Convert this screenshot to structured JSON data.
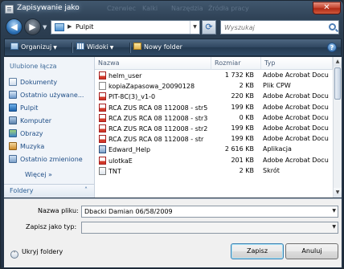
{
  "window": {
    "title": "Zapisywanie jako",
    "close_glyph": "✕",
    "ghost_menu": [
      "Czerwiec",
      "Kalki",
      "Narzędzia",
      "Źródła pracy"
    ]
  },
  "address": {
    "location": "Pulpit",
    "back_glyph": "◀",
    "forward_glyph": "▶",
    "refresh_glyph": "⟳"
  },
  "search": {
    "placeholder": "Wyszukaj"
  },
  "toolbar": {
    "organize": "Organizuj",
    "views": "Widoki",
    "new_folder": "Nowy folder",
    "help": "?"
  },
  "sidebar": {
    "heading": "Ulubione łącza",
    "items": [
      {
        "label": "Dokumenty",
        "icon": "documents-icon"
      },
      {
        "label": "Ostatnio używane...",
        "icon": "recent-places-icon"
      },
      {
        "label": "Pulpit",
        "icon": "desktop-icon"
      },
      {
        "label": "Komputer",
        "icon": "computer-icon"
      },
      {
        "label": "Obrazy",
        "icon": "pictures-icon"
      },
      {
        "label": "Muzyka",
        "icon": "music-icon"
      },
      {
        "label": "Ostatnio zmienione",
        "icon": "recently-changed-icon"
      }
    ],
    "more": "Więcej",
    "more_glyph": "»",
    "folders": "Foldery",
    "folders_glyph": "˄"
  },
  "columns": {
    "name": "Nazwa",
    "size": "Rozmiar",
    "type": "Typ"
  },
  "files": [
    {
      "name": "helm_user",
      "size": "1 732 KB",
      "type": "Adobe Acrobat Docu",
      "icon": "pdf-file-icon"
    },
    {
      "name": "kopiaZapasowa_20090128",
      "size": "2 KB",
      "type": "Plik CPW",
      "icon": "generic-file-icon"
    },
    {
      "name": "PIT-8C(3)_v1-0",
      "size": "220 KB",
      "type": "Adobe Acrobat Docu",
      "icon": "pdf-file-icon"
    },
    {
      "name": "RCA ZUS RCA 08 112008 - str5",
      "size": "199 KB",
      "type": "Adobe Acrobat Docu",
      "icon": "pdf-file-icon"
    },
    {
      "name": "RCA ZUS RCA 08 112008 - str3",
      "size": "0 KB",
      "type": "Adobe Acrobat Docu",
      "icon": "pdf-file-icon"
    },
    {
      "name": "RCA ZUS RCA 08 112008 - str2",
      "size": "199 KB",
      "type": "Adobe Acrobat Docu",
      "icon": "pdf-file-icon"
    },
    {
      "name": "RCA ZUS RCA 08 112008 - str",
      "size": "199 KB",
      "type": "Adobe Acrobat Docu",
      "icon": "pdf-file-icon"
    },
    {
      "name": "Edward_Help",
      "size": "2 616 KB",
      "type": "Aplikacja",
      "icon": "application-icon"
    },
    {
      "name": "ulotkaE",
      "size": "201 KB",
      "type": "Adobe Acrobat Docu",
      "icon": "pdf-file-icon"
    },
    {
      "name": "TNT",
      "size": "2 KB",
      "type": "Skrót",
      "icon": "shortcut-icon"
    }
  ],
  "form": {
    "filename_label": "Nazwa pliku:",
    "filename_value": "Dbacki Damian 06/58/2009",
    "savetype_label": "Zapisz jako typ:",
    "savetype_value": ""
  },
  "footer": {
    "hide_folders": "Ukryj foldery",
    "save": "Zapisz",
    "cancel": "Anuluj"
  }
}
